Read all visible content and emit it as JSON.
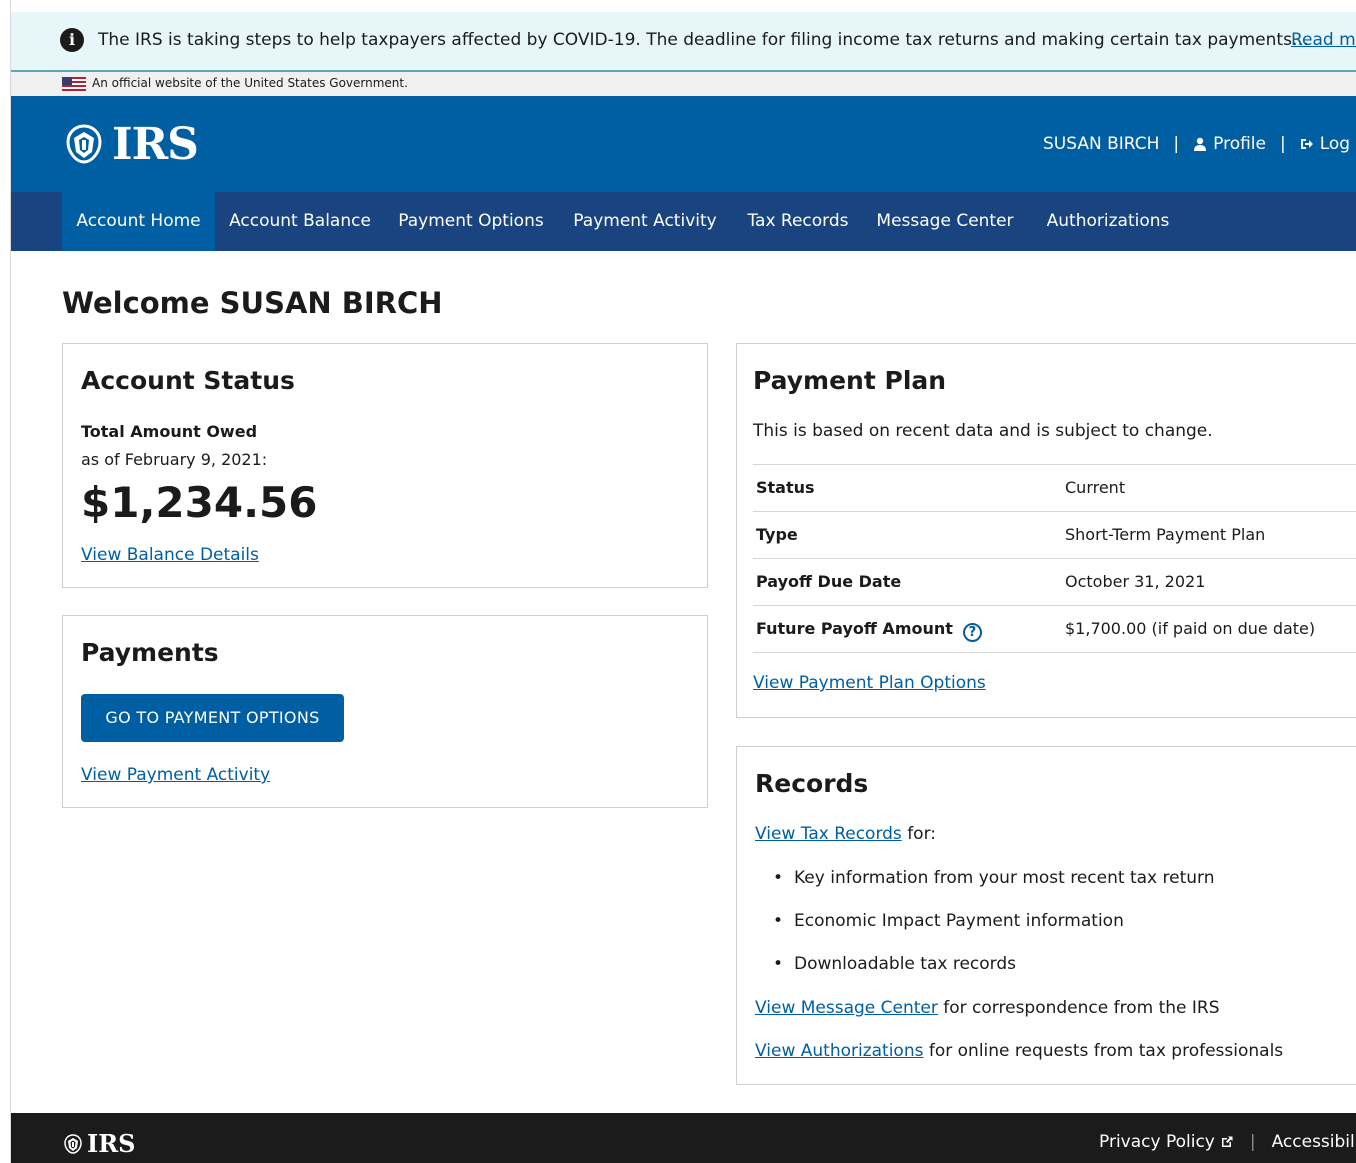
{
  "alert": {
    "message": "The IRS is taking steps to help taxpayers affected by COVID-19. The deadline for filing income tax returns and making certain tax payments…",
    "read_more": "Read more"
  },
  "gov_banner": {
    "text": "An official website of the United States Government."
  },
  "header": {
    "logo_text": "IRS",
    "user_name": "SUSAN BIRCH",
    "profile_label": "Profile",
    "logout_label": "Log out",
    "separator": "|"
  },
  "nav": {
    "items": [
      {
        "label": "Account Home",
        "active": true
      },
      {
        "label": "Account Balance"
      },
      {
        "label": "Payment Options"
      },
      {
        "label": "Payment Activity"
      },
      {
        "label": "Tax Records"
      },
      {
        "label": "Message Center"
      },
      {
        "label": "Authorizations"
      }
    ]
  },
  "main": {
    "welcome": "Welcome SUSAN BIRCH",
    "account_status": {
      "title": "Account Status",
      "label": "Total Amount Owed",
      "as_of": "as of February 9, 2021:",
      "amount": "$1,234.56",
      "link": "View Balance Details"
    },
    "payments": {
      "title": "Payments",
      "button": "GO TO PAYMENT OPTIONS",
      "link": "View Payment Activity"
    },
    "payment_plan": {
      "title": "Payment Plan",
      "subtitle": "This is based on recent data and is subject to change.",
      "rows": [
        {
          "key": "Status",
          "value": "Current"
        },
        {
          "key": "Type",
          "value": "Short-Term Payment Plan"
        },
        {
          "key": "Payoff Due Date",
          "value": "October 31, 2021"
        },
        {
          "key": "Future Payoff Amount",
          "value": "$1,700.00  (if paid on due date)"
        }
      ],
      "help_glyph": "?",
      "link": "View Payment Plan Options"
    },
    "records": {
      "title": "Records",
      "tax_records_link": "View Tax Records",
      "tax_records_suffix": " for:",
      "bullets": [
        "Key information from your most recent tax return",
        "Economic Impact Payment information",
        "Downloadable tax records"
      ],
      "message_center_link": "View Message Center",
      "message_center_suffix": " for correspondence from the IRS",
      "authorizations_link": "View Authorizations",
      "authorizations_suffix": " for online requests from tax professionals"
    }
  },
  "footer": {
    "logo_text": "IRS",
    "privacy_policy": "Privacy Policy",
    "accessibility": "Accessibility",
    "separator": "|"
  },
  "colors": {
    "primary_blue": "#005ea2",
    "nav_dark_blue": "#1a4480",
    "alert_bg": "#e7f6f8",
    "footer_bg": "#1b1b1b"
  },
  "icons": [
    "info-icon",
    "us-flag-icon",
    "irs-eagle-icon",
    "user-icon",
    "logout-icon",
    "help-icon",
    "external-link-icon"
  ]
}
